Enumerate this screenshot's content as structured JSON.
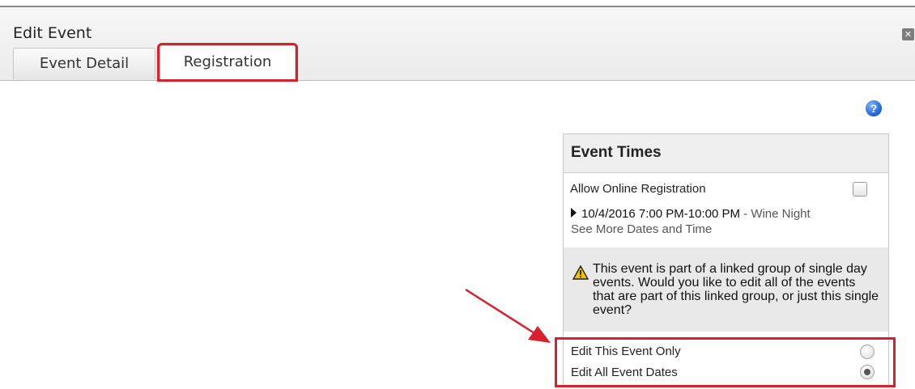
{
  "dialog": {
    "title": "Edit Event",
    "close_icon": "close-icon"
  },
  "tabs": [
    {
      "label": "Event Detail",
      "active": false
    },
    {
      "label": "Registration",
      "active": true
    }
  ],
  "help_icon": "help-icon",
  "event_times": {
    "title": "Event Times",
    "allow_online_label": "Allow Online Registration",
    "allow_online_checked": false,
    "event_datetime": "10/4/2016 7:00 PM-10:00 PM",
    "event_separator": " - ",
    "event_name": "Wine Night",
    "see_more": "See More Dates and Time",
    "warning_icon": "warning-icon",
    "warning_text": "This event is part of a linked group of single day events. Would you like to edit all of the events that are part of this linked group, or just this single event?",
    "options": [
      {
        "label": "Edit This Event Only",
        "selected": false
      },
      {
        "label": "Edit All Event Dates",
        "selected": true
      }
    ]
  },
  "colors": {
    "highlight": "#d9202f",
    "help_blue": "#1b5fd1"
  }
}
